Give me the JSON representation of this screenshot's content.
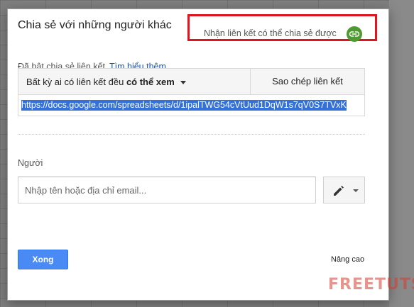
{
  "dialog": {
    "title": "Chia sẻ với những người khác",
    "get_link": {
      "label": "Nhận liên kết có thể chia sẻ được",
      "icon": "link-icon",
      "highlight_color": "#e0141e",
      "icon_color": "#4e9a30"
    },
    "share_status": "Đã bật chia sẻ liên kết",
    "learn_more": "Tìm hiểu thêm",
    "access": {
      "prefix": "Bất kỳ ai có liên kết đều",
      "level": "có thể xem"
    },
    "copy_link": "Sao chép liên kết",
    "url": "https://docs.google.com/spreadsheets/d/1ipalTWG54cVtUud1DqW1s7qV0S7TVxK",
    "people": {
      "label": "Người",
      "placeholder": "Nhập tên hoặc địa chỉ email...",
      "permission_icon": "pencil-icon"
    },
    "done": "Xong",
    "advanced": "Nâng cao"
  },
  "watermark": "FREETUTS"
}
